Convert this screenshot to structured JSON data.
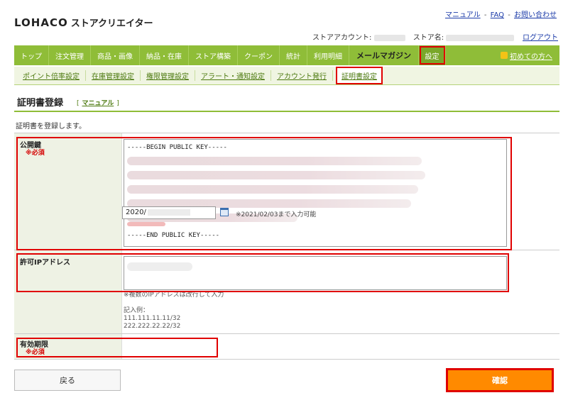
{
  "header": {
    "logo": "LOHACO",
    "logo_sub": "ストアクリエイター",
    "links": [
      "マニュアル",
      "FAQ",
      "お問い合わせ"
    ],
    "link_sep": "-",
    "account_label": "ストアアカウント:",
    "store_label": "ストア名:",
    "logout": "ログアウト"
  },
  "nav": {
    "items": [
      "トップ",
      "注文管理",
      "商品・画像",
      "納品・在庫",
      "ストア構築",
      "クーポン",
      "統計",
      "利用明細",
      "メールマガジン",
      "設定"
    ],
    "active_index": 9,
    "guide": "初めての方へ"
  },
  "subnav": {
    "items": [
      "ポイント倍率設定",
      "在庫管理設定",
      "権限管理設定",
      "アラート・通知設定",
      "アカウント発行",
      "証明書設定"
    ],
    "active_index": 5
  },
  "page": {
    "title": "証明書登録",
    "manual_bracket_open": "[",
    "manual_link": "マニュアル",
    "manual_bracket_close": "]",
    "intro": "証明書を登録します。"
  },
  "form": {
    "public_key": {
      "label": "公開鍵",
      "required": "※必須",
      "begin": "-----BEGIN PUBLIC KEY-----",
      "end": "-----END PUBLIC KEY-----"
    },
    "ip": {
      "label": "許可IPアドレス",
      "note": "※複数のIPアドレスは改行して入力",
      "example_title": "記入例：",
      "examples": [
        "111.111.11.11/32",
        "222.222.22.22/32"
      ]
    },
    "expiry": {
      "label": "有効期限",
      "required": "※必須",
      "value": "2020/",
      "note": "※2021/02/03まで入力可能"
    }
  },
  "buttons": {
    "back": "戻る",
    "confirm": "確認"
  },
  "colors": {
    "nav_green": "#8fbd38",
    "highlight_red": "#e00000",
    "confirm_orange": "#ff8a00",
    "required_red": "#d40000"
  }
}
